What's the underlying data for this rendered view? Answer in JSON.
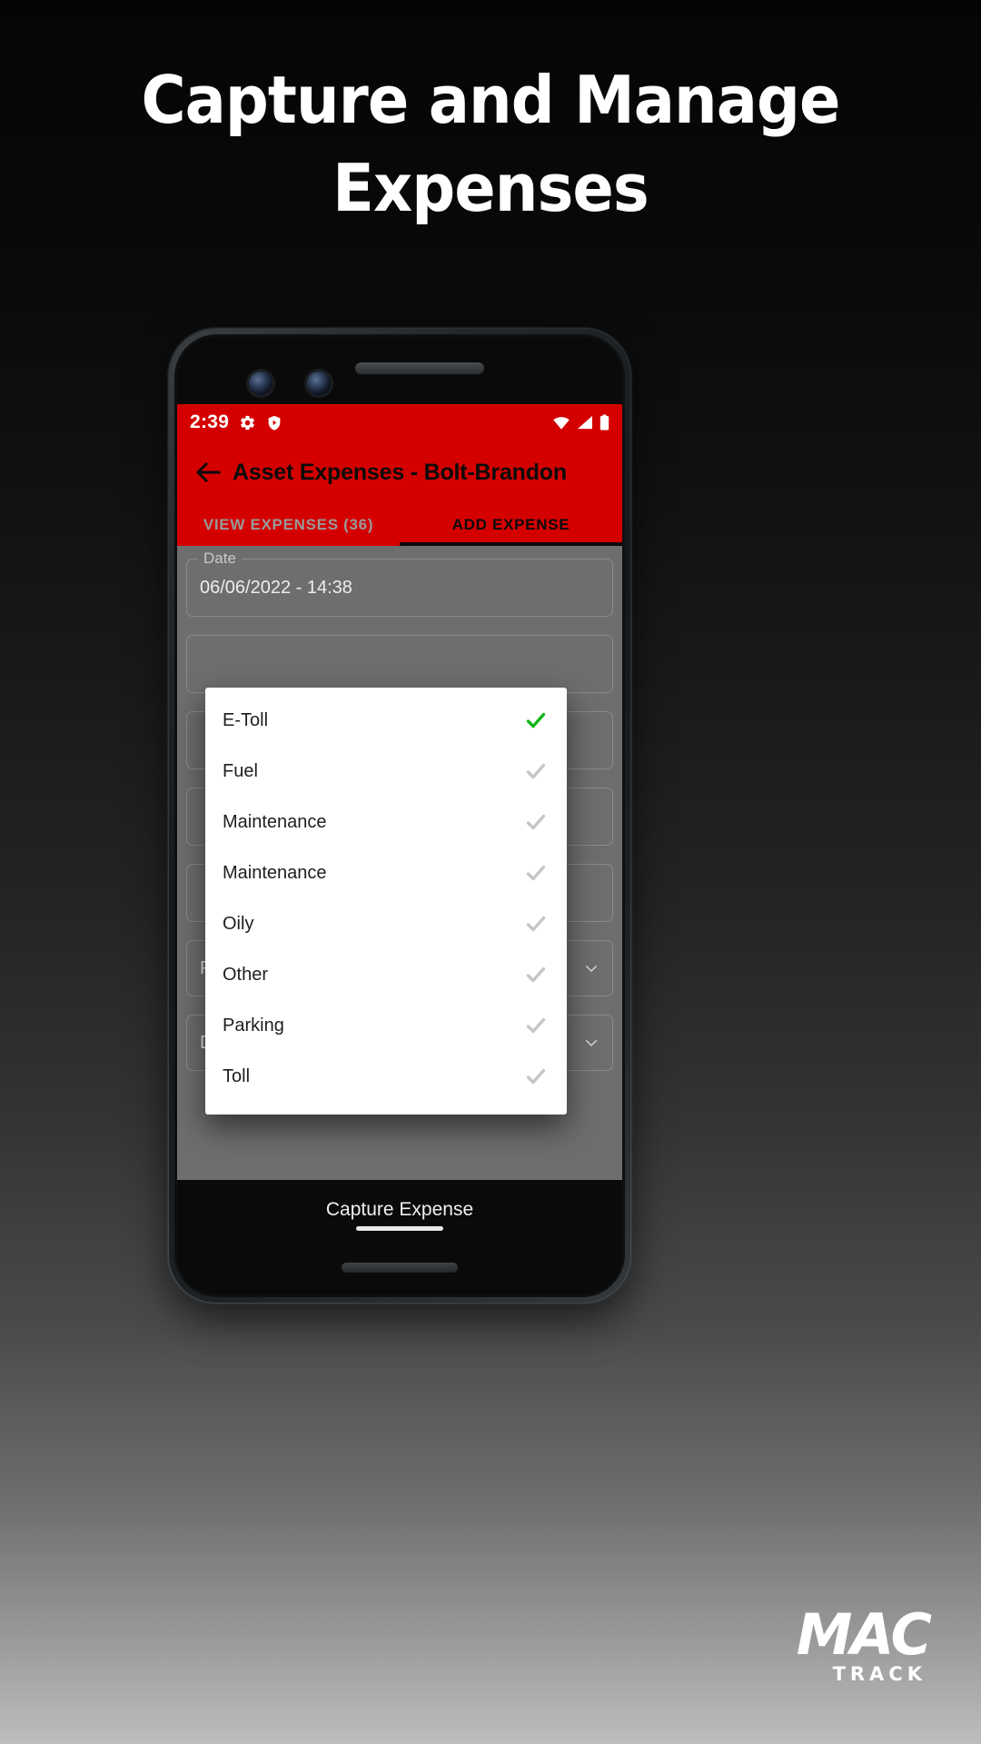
{
  "promo": {
    "headline_line1": "Capture and Manage",
    "headline_line2": "Expenses"
  },
  "status_bar": {
    "time": "2:39",
    "icons": [
      "gear-icon",
      "shield-play-icon",
      "wifi-icon",
      "signal-icon",
      "battery-icon"
    ]
  },
  "app_bar": {
    "back_icon": "back-arrow-icon",
    "title": "Asset Expenses - Bolt-Brandon"
  },
  "tabs": [
    {
      "label": "VIEW EXPENSES (36)",
      "active": false
    },
    {
      "label": "ADD EXPENSE",
      "active": true
    }
  ],
  "form": {
    "date_field": {
      "legend": "Date",
      "value": "06/06/2022 - 14:38"
    },
    "project_select": {
      "value": "Project: None",
      "icon": "chevron-down-icon"
    },
    "driver_select": {
      "value": "Driver: None",
      "icon": "chevron-down-icon"
    }
  },
  "dropdown": {
    "items": [
      {
        "label": "E-Toll",
        "selected": true
      },
      {
        "label": "Fuel",
        "selected": false
      },
      {
        "label": "Maintenance",
        "selected": false
      },
      {
        "label": "Maintenance",
        "selected": false
      },
      {
        "label": "Oily",
        "selected": false
      },
      {
        "label": "Other",
        "selected": false
      },
      {
        "label": "Parking",
        "selected": false
      },
      {
        "label": "Toll",
        "selected": false
      }
    ]
  },
  "cta": {
    "label": "Capture Expense"
  },
  "watermark": {
    "main": "MAC",
    "sub": "TRACK"
  },
  "colors": {
    "brand_red": "#D40000",
    "check_green": "#12B516",
    "check_gray": "#c6c6c6",
    "dialog_bg": "#ffffff",
    "dim_overlay": "#6e6e6e"
  }
}
